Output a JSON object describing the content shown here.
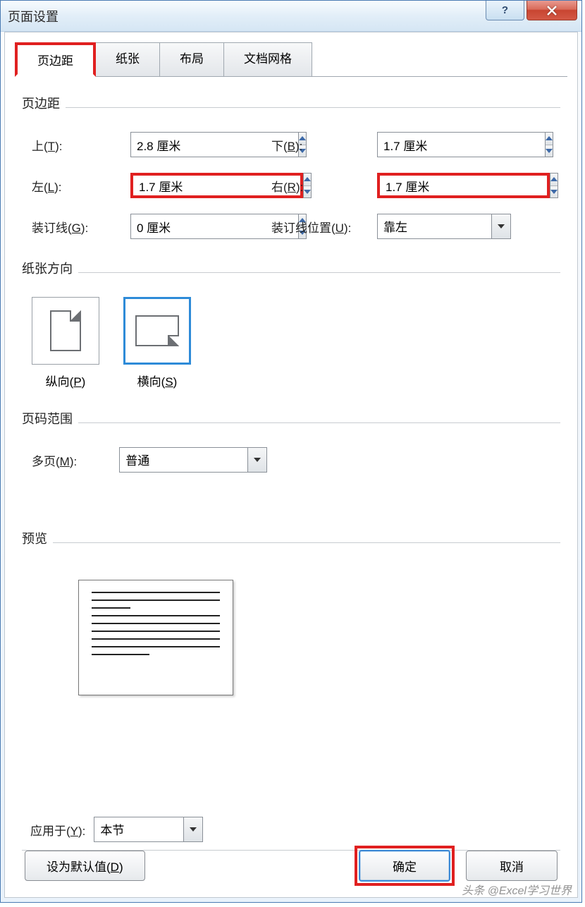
{
  "title": "页面设置",
  "tabs": {
    "margins": "页边距",
    "paper": "纸张",
    "layout": "布局",
    "grid": "文档网格"
  },
  "margins_group": {
    "label": "页边距",
    "top_label": "上(T):",
    "top_value": "2.8 厘米",
    "bottom_label": "下(B):",
    "bottom_value": "1.7 厘米",
    "left_label": "左(L):",
    "left_value": "1.7 厘米",
    "right_label": "右(R):",
    "right_value": "1.7 厘米",
    "gutter_label": "装订线(G):",
    "gutter_value": "0 厘米",
    "gutter_pos_label": "装订线位置(U):",
    "gutter_pos_value": "靠左"
  },
  "orientation": {
    "label": "纸张方向",
    "portrait": "纵向(P)",
    "landscape": "横向(S)",
    "selected": "landscape"
  },
  "pages": {
    "label": "页码范围",
    "multi_label": "多页(M):",
    "multi_value": "普通"
  },
  "preview": {
    "label": "预览"
  },
  "apply": {
    "label": "应用于(Y):",
    "value": "本节"
  },
  "buttons": {
    "default": "设为默认值(D)",
    "ok": "确定",
    "cancel": "取消"
  },
  "watermark": "头条 @Excel学习世界"
}
